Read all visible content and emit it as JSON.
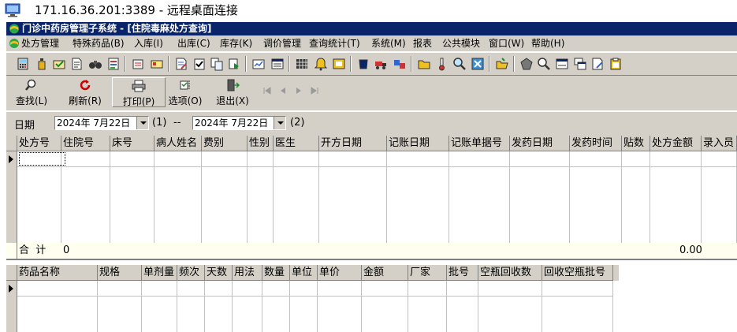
{
  "window": {
    "rdp_title": "171.16.36.201:3389 - 远程桌面连接"
  },
  "app": {
    "title": "门诊中药房管理子系统 - [住院毒麻处方查询]"
  },
  "menu": [
    "处方管理",
    "特殊药品(B)",
    "入库(I)",
    "出库(C)",
    "库存(K)",
    "调价管理",
    "查询统计(T)",
    "系统(M)",
    "报表",
    "公共模块",
    "窗口(W)",
    "帮助(H)"
  ],
  "actions": {
    "search": "查找(L)",
    "refresh": "刷新(R)",
    "print": "打印(P)",
    "options": "选项(O)",
    "exit": "退出(X)"
  },
  "filter": {
    "label": "日期",
    "from": "2024年 7月22日",
    "from_shortcut": "(1)",
    "separator": "--",
    "to": "2024年 7月22日",
    "to_shortcut": "(2)"
  },
  "prescription_table": {
    "columns": [
      "处方号",
      "住院号",
      "床号",
      "病人姓名",
      "费别",
      "性别",
      "医生",
      "开方日期",
      "记账日期",
      "记账单据号",
      "发药日期",
      "发药时间",
      "贴数",
      "处方金额",
      "录入员"
    ],
    "total_label": "合  计",
    "total_count": "0",
    "total_amount": "0.00"
  },
  "drug_table": {
    "columns": [
      "药品名称",
      "规格",
      "单剂量",
      "频次",
      "天数",
      "用法",
      "数量",
      "单位",
      "单价",
      "金额",
      "厂家",
      "批号",
      "空瓶回收数",
      "回收空瓶批号"
    ]
  },
  "colors": {
    "title_bar": "#0a246a",
    "face": "#d4d0c8",
    "total_row": "#fffff0"
  }
}
